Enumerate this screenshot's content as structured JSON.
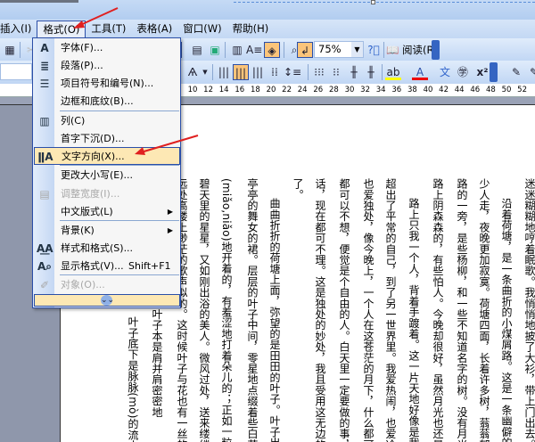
{
  "menubar": {
    "items": [
      "插入(I)",
      "格式(O)",
      "工具(T)",
      "表格(A)",
      "窗口(W)",
      "帮助(H)"
    ]
  },
  "toolbar": {
    "zoom": "75%",
    "read_label": "阅读(R)"
  },
  "ruler": {
    "ticks": [
      "10",
      "12",
      "14",
      "16",
      "18",
      "20",
      "22",
      "24",
      "26",
      "28",
      "30",
      "32",
      "34",
      "36",
      "38",
      "40",
      "42",
      "44",
      "46",
      "48",
      "50",
      "52"
    ]
  },
  "format_menu": {
    "items": [
      {
        "label": "字体(F)...",
        "icon": "font-icon"
      },
      {
        "label": "段落(P)...",
        "icon": "paragraph-icon"
      },
      {
        "label": "项目符号和编号(N)...",
        "icon": "bullets-icon"
      },
      {
        "label": "边框和底纹(B)..."
      },
      {
        "label": "列(C)",
        "icon": "columns-icon"
      },
      {
        "label": "首字下沉(D)..."
      },
      {
        "label": "文字方向(X)...",
        "icon": "text-direction-icon"
      },
      {
        "label": "更改大小写(E)..."
      },
      {
        "label": "调整宽度(I)...",
        "icon": "fit-width-icon"
      },
      {
        "label": "中文版式(L)"
      },
      {
        "label": "背景(K)"
      },
      {
        "label": "样式和格式(S)...",
        "icon": "styles-icon"
      },
      {
        "label": "显示格式(V)...",
        "shortcut": "Shift+F1",
        "icon": "reveal-format-icon"
      },
      {
        "label": "对象(O)...",
        "icon": "object-icon"
      }
    ]
  },
  "document": {
    "columns": [
      "迷迷糊糊地哼着眠歌。我悄悄地披了大衫，带上门出去。",
      "沿着荷塘，是一条曲折的小煤屑路。这是一条幽僻的路",
      "少人走，夜晚更加寂寞。荷塘四面，长着许多树，蓊蓊郁郁",
      "路的一旁，是些杨柳，和一些不知道名字的树。没有月光的",
      "路上阴森森的，有些怕人。今晚却很好，虽然月光也还是淡",
      "路上只我一个人，背着手踱着。这一片天地好像是我的",
      "超出了平常的自己，到了另一世界里。我爱热闹，也爱冷静",
      "也爱独处，像今晚上，一个人在这苍茫的月下，什么都可以",
      "都可以不想，便觉是个自由的人。白天里一定要做的事，一",
      "话，现在都可不理。这是独处的妙处，我且受用这无边的荷",
      "了。",
      "曲曲折折的荷塘上面，弥望的是田田的叶子。叶子出水",
      "亭亭的舞女的裙。层层的叶子中间，零星地点缀着些白花",
      "(miǎo,niǎo)地开着的，有羞涩地打着朵儿的；正如一粒粒的",
      "碧天里的星星，又如刚出浴的美人。微风过处，送来缕缕清",
      "远处高楼上渺茫的歌声似的。这时候叶子与花也有一丝的颤",
      "霎时传过荷塘的那边去了。叶子本是肩并肩密密地",
      "叶子底下是脉脉(mò)的流水，"
    ]
  },
  "colors": {
    "highlight": "#fde8b4",
    "accent": "#2b4fa8",
    "arrow": "#e02020"
  }
}
